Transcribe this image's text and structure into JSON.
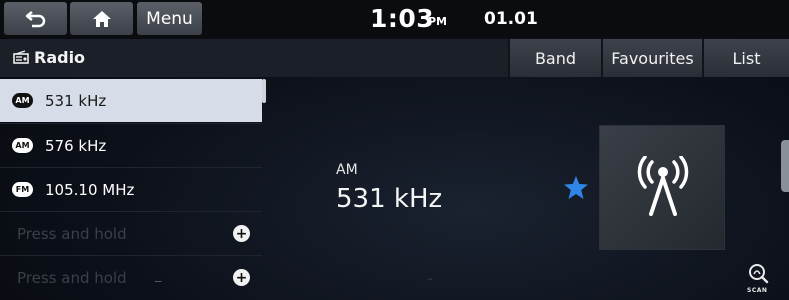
{
  "statusbar": {
    "menu_label": "Menu",
    "time": "1:03",
    "ampm": "PM",
    "date": "01.01"
  },
  "titlebar": {
    "title": "Radio",
    "buttons": {
      "band": "Band",
      "favourites": "Favourites",
      "list": "List"
    }
  },
  "presets": [
    {
      "band": "AM",
      "freq": "531 kHz",
      "selected": true
    },
    {
      "band": "AM",
      "freq": "576 kHz",
      "selected": false
    },
    {
      "band": "FM",
      "freq": "105.10 MHz",
      "selected": false
    },
    {
      "band": "",
      "freq": "Press and hold",
      "selected": false
    },
    {
      "band": "",
      "freq": "Press and hold",
      "selected": false
    }
  ],
  "now_playing": {
    "band": "AM",
    "frequency": "531 kHz",
    "favourite": true
  },
  "scan_label": "SCAN",
  "colors": {
    "accent_star": "#2f86e6",
    "selected_row": "#d6dde8"
  }
}
